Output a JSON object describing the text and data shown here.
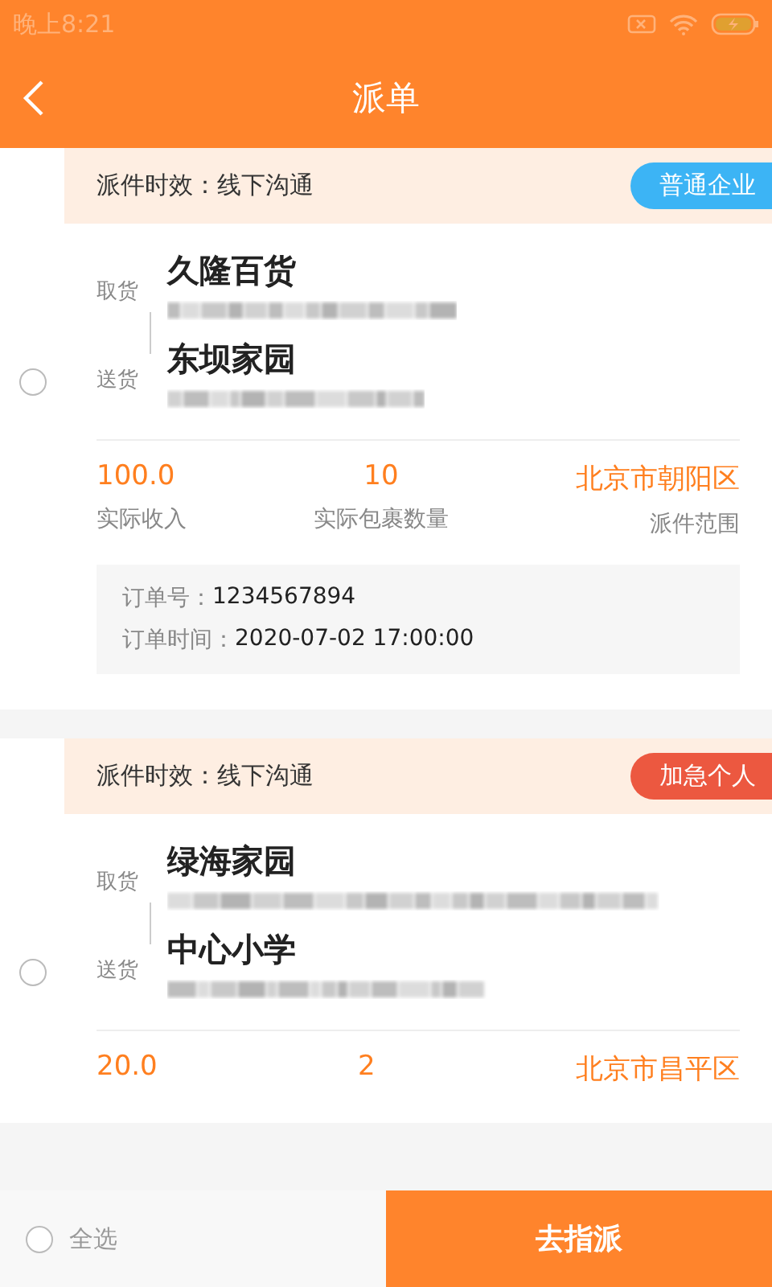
{
  "status_bar": {
    "time": "晚上8:21"
  },
  "header": {
    "title": "派单"
  },
  "orders": [
    {
      "selected": false,
      "timing": "派件时效：线下沟通",
      "tag": {
        "label": "普通企业",
        "color": "#3cb4f5"
      },
      "pickup": {
        "label": "取货",
        "name": "久隆百货"
      },
      "delivery": {
        "label": "送货",
        "name": "东坝家园"
      },
      "stats": [
        {
          "value": "100.0",
          "label": "实际收入"
        },
        {
          "value": "10",
          "label": "实际包裹数量"
        },
        {
          "value": "北京市朝阳区",
          "label": "派件范围"
        }
      ],
      "details": [
        {
          "label": "订单号：",
          "value": "1234567894"
        },
        {
          "label": "订单时间：",
          "value": "2020-07-02 17:00:00"
        }
      ]
    },
    {
      "selected": false,
      "timing": "派件时效：线下沟通",
      "tag": {
        "label": "加急个人",
        "color": "#ec5840"
      },
      "pickup": {
        "label": "取货",
        "name": "绿海家园"
      },
      "delivery": {
        "label": "送货",
        "name": "中心小学"
      },
      "stats": [
        {
          "value": "20.0"
        },
        {
          "value": "2"
        },
        {
          "value": "北京市昌平区"
        }
      ]
    }
  ],
  "footer": {
    "select_all": {
      "label": "全选",
      "checked": false
    },
    "action": "去指派"
  }
}
